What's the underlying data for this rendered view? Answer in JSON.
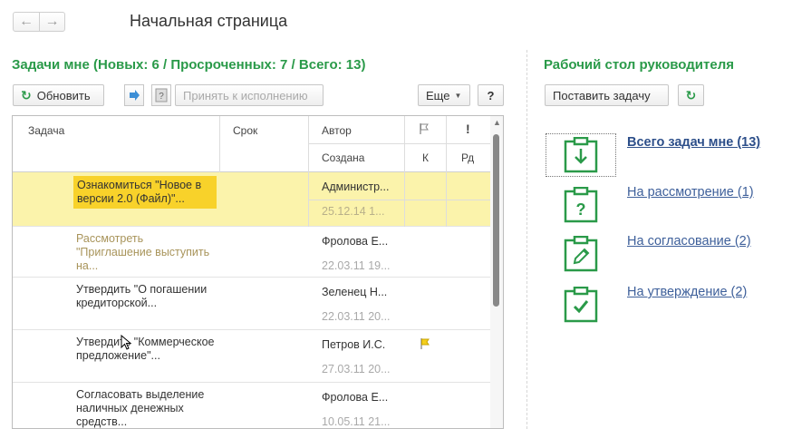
{
  "nav": {
    "back_icon": "arrow-left-icon",
    "forward_icon": "arrow-right-icon"
  },
  "page_title": "Начальная страница",
  "tasks_panel": {
    "title": "Задачи мне (Новых: 6 / Просроченных: 7 / Всего: 13)",
    "toolbar": {
      "refresh_label": "Обновить",
      "accept_label": "Принять к исполнению",
      "more_label": "Еще",
      "help_label": "?"
    },
    "columns": {
      "task": "Задача",
      "deadline": "Срок",
      "author": "Автор",
      "created": "Создана",
      "control": "К",
      "importance": "!",
      "subtasks": "Рд"
    },
    "rows": [
      {
        "task": "Ознакомиться \"Новое в версии 2.0 (Файл)\"...",
        "author": "Администр...",
        "created": "25.12.14 1..."
      },
      {
        "task": "Рассмотреть \"Приглашение выступить на...",
        "author": "Фролова Е...",
        "created": "22.03.11 19..."
      },
      {
        "task": "Утвердить \"О погашении кредиторской...",
        "author": "Зеленец Н...",
        "created": "22.03.11 20..."
      },
      {
        "task": "Утвердить \"Коммерческое предложение\"...",
        "author": "Петров И.С.",
        "created": "27.03.11 20..."
      },
      {
        "task": "Согласовать выделение наличных денежных средств...",
        "author": "Фролова Е...",
        "created": "10.05.11 21..."
      }
    ]
  },
  "dashboard": {
    "title": "Рабочий стол руководителя",
    "set_task_label": "Поставить задачу",
    "items": [
      {
        "label": "Всего задач мне (13)",
        "icon": "clipboard-down-arrow-icon"
      },
      {
        "label": "На рассмотрение (1)",
        "icon": "clipboard-question-icon"
      },
      {
        "label": "На согласование (2)",
        "icon": "clipboard-pencil-icon"
      },
      {
        "label": "На утверждение (2)",
        "icon": "clipboard-check-icon"
      }
    ]
  },
  "colors": {
    "accent_green": "#2a9a49",
    "link_blue": "#3d5f9a",
    "selected_row": "#fbf3ab",
    "selected_cell": "#f8d22a"
  }
}
